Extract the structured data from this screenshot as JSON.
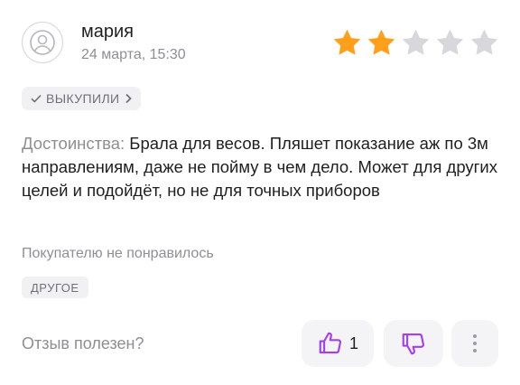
{
  "review": {
    "author": "мария",
    "date": "24 марта, 15:30",
    "rating": 2,
    "max_rating": 5,
    "purchased_badge": "ВЫКУПИЛИ",
    "pros_label": "Достоинства:",
    "pros_text": "Брала для весов. Пляшет показание аж по 3м направлениям, даже не пойму в чем дело. Может для других целей и подойдёт,  но не для точных приборов",
    "verdict": "Покупателю не понравилось",
    "tag": "ДРУГОЕ"
  },
  "feedback": {
    "question": "Отзыв полезен?",
    "likes": "1"
  },
  "colors": {
    "star_active": "#ff9f1a",
    "star_inactive": "#d7d7dc",
    "accent": "#a63df0",
    "muted_text": "#8e8e95",
    "chip_bg": "#f1f1f4"
  },
  "icons": {
    "avatar": "user-avatar-icon",
    "check": "check-icon",
    "chevron": "chevron-right-icon",
    "like": "thumbs-up-icon",
    "dislike": "thumbs-down-icon",
    "more": "more-vertical-icon",
    "star": "star-icon"
  }
}
